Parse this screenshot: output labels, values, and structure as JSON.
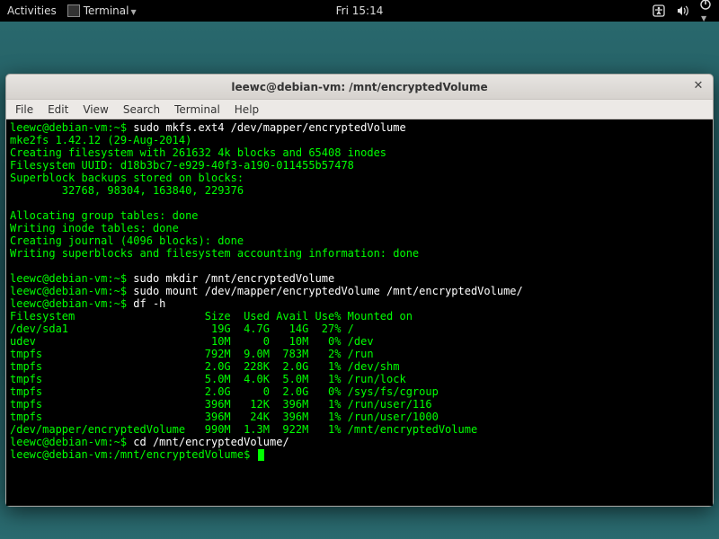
{
  "panel": {
    "activities": "Activities",
    "app": "Terminal",
    "clock": "Fri 15:14"
  },
  "window": {
    "title": "leewc@debian-vm: /mnt/encryptedVolume",
    "menu": {
      "file": "File",
      "edit": "Edit",
      "view": "View",
      "search": "Search",
      "terminal": "Terminal",
      "help": "Help"
    }
  },
  "term": {
    "prompt_home": "leewc@debian-vm:~$ ",
    "prompt_mnt": "leewc@debian-vm:/mnt/encryptedVolume$ ",
    "cmd1": "sudo mkfs.ext4 /dev/mapper/encryptedVolume",
    "mk1": "mke2fs 1.42.12 (29-Aug-2014)",
    "mk2": "Creating filesystem with 261632 4k blocks and 65408 inodes",
    "mk3": "Filesystem UUID: d18b3bc7-e929-40f3-a190-011455b57478",
    "mk4": "Superblock backups stored on blocks:",
    "mk5": "        32768, 98304, 163840, 229376",
    "mk6": "Allocating group tables: done",
    "mk7": "Writing inode tables: done",
    "mk8": "Creating journal (4096 blocks): done",
    "mk9": "Writing superblocks and filesystem accounting information: done",
    "cmd2": "sudo mkdir /mnt/encryptedVolume",
    "cmd3": "sudo mount /dev/mapper/encryptedVolume /mnt/encryptedVolume/",
    "cmd4": "df -h",
    "dfhdr": "Filesystem                    Size  Used Avail Use% Mounted on",
    "df1": "/dev/sda1                      19G  4.7G   14G  27% /",
    "df2": "udev                           10M     0   10M   0% /dev",
    "df3": "tmpfs                         792M  9.0M  783M   2% /run",
    "df4": "tmpfs                         2.0G  228K  2.0G   1% /dev/shm",
    "df5": "tmpfs                         5.0M  4.0K  5.0M   1% /run/lock",
    "df6": "tmpfs                         2.0G     0  2.0G   0% /sys/fs/cgroup",
    "df7": "tmpfs                         396M   12K  396M   1% /run/user/116",
    "df8": "tmpfs                         396M   24K  396M   1% /run/user/1000",
    "df9": "/dev/mapper/encryptedVolume   990M  1.3M  922M   1% /mnt/encryptedVolume",
    "cmd5": "cd /mnt/encryptedVolume/"
  },
  "chart_data": {
    "type": "table",
    "title": "df -h",
    "columns": [
      "Filesystem",
      "Size",
      "Used",
      "Avail",
      "Use%",
      "Mounted on"
    ],
    "rows": [
      [
        "/dev/sda1",
        "19G",
        "4.7G",
        "14G",
        "27%",
        "/"
      ],
      [
        "udev",
        "10M",
        "0",
        "10M",
        "0%",
        "/dev"
      ],
      [
        "tmpfs",
        "792M",
        "9.0M",
        "783M",
        "2%",
        "/run"
      ],
      [
        "tmpfs",
        "2.0G",
        "228K",
        "2.0G",
        "1%",
        "/dev/shm"
      ],
      [
        "tmpfs",
        "5.0M",
        "4.0K",
        "5.0M",
        "1%",
        "/run/lock"
      ],
      [
        "tmpfs",
        "2.0G",
        "0",
        "2.0G",
        "0%",
        "/sys/fs/cgroup"
      ],
      [
        "tmpfs",
        "396M",
        "12K",
        "396M",
        "1%",
        "/run/user/116"
      ],
      [
        "tmpfs",
        "396M",
        "24K",
        "396M",
        "1%",
        "/run/user/1000"
      ],
      [
        "/dev/mapper/encryptedVolume",
        "990M",
        "1.3M",
        "922M",
        "1%",
        "/mnt/encryptedVolume"
      ]
    ]
  }
}
